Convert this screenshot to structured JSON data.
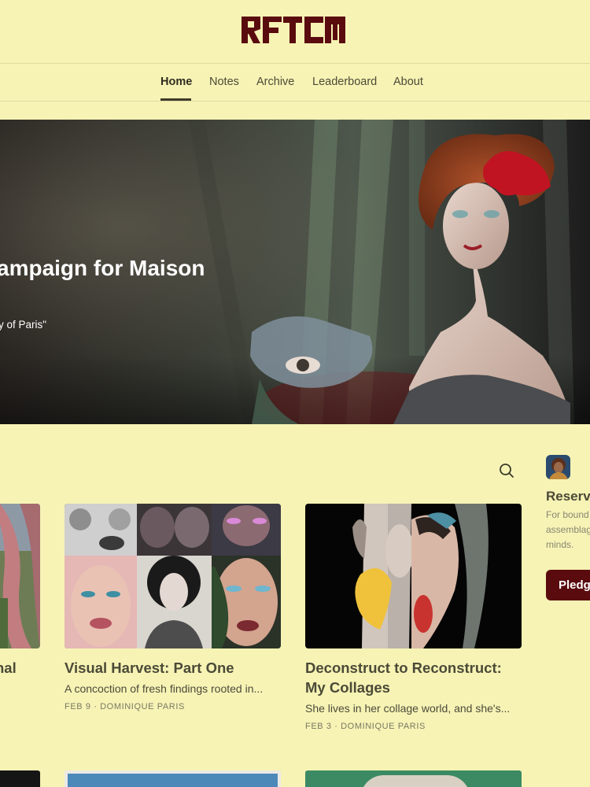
{
  "header": {
    "logo_text": "RFTCM"
  },
  "nav": {
    "items": [
      {
        "label": "Home",
        "active": true
      },
      {
        "label": "Notes"
      },
      {
        "label": "Archive"
      },
      {
        "label": "Leaderboard"
      },
      {
        "label": "About"
      }
    ]
  },
  "hero": {
    "title": "ampaign for Maison",
    "subtitle": "y of Paris\""
  },
  "search": {
    "icon": "search-icon"
  },
  "posts": [
    {
      "title": "nal"
    },
    {
      "title": "Visual Harvest: Part One",
      "excerpt": "A concoction of fresh findings rooted in...",
      "meta": "FEB 9 · DOMINIQUE PARIS"
    },
    {
      "title_line1": "Deconstruct to Reconstruct:",
      "title_line2": "My Collages",
      "excerpt": "She lives in her collage world, and she's...",
      "meta": "FEB 3 · DOMINIQUE PARIS"
    }
  ],
  "sidebar": {
    "title": "Reserve",
    "description_lines": [
      "For bound",
      "assemblag",
      "minds."
    ],
    "button_label": "Pledge"
  },
  "colors": {
    "background": "#f6f3b5",
    "accent": "#5a0b0e",
    "logo": "#5a0b0e"
  }
}
